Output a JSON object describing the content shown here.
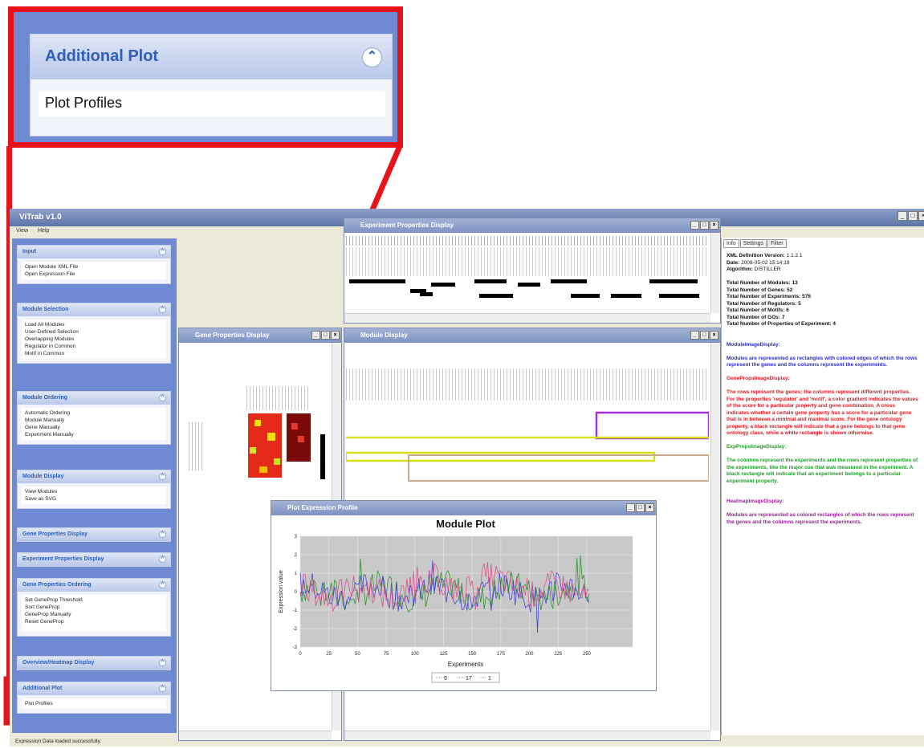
{
  "zoom": {
    "header": "Additional Plot",
    "item": "Plot Profiles"
  },
  "app": {
    "title": "ViTrab v1.0",
    "menu": [
      "View",
      "Help"
    ],
    "status": "Expression Data loaded successfully."
  },
  "sidebar": {
    "sections": [
      {
        "title": "Input",
        "items": [
          "Open Module XML File",
          "Open Expression File"
        ]
      },
      {
        "title": "Module Selection",
        "items": [
          "Load All Modules",
          "User-Defined Selection",
          "Overlapping Modules",
          "Regulator in Common",
          "Motif in Common"
        ]
      },
      {
        "title": "Module Ordering",
        "items": [
          "Automatic Ordering",
          "Module Manually",
          "Gene Manually",
          "Experiment Manually"
        ]
      },
      {
        "title": "Module Display",
        "items": [
          "View Modules",
          "Save as SVG"
        ]
      },
      {
        "title": "Gene Properties Display",
        "items": []
      },
      {
        "title": "Experiment Properties Display",
        "items": []
      },
      {
        "title": "Gene Properties Ordering",
        "items": [
          "Set GeneProp Threshold",
          "Sort GeneProp",
          "GeneProp Manually",
          "Reset GeneProp"
        ]
      },
      {
        "title": "Overview/Heatmap Display",
        "items": []
      },
      {
        "title": "Additional Plot",
        "items": [
          "Plot Profiles"
        ]
      }
    ]
  },
  "windows": {
    "experiment": "Experiment Properties Display",
    "gene": "Gene Properties Display",
    "module": "Module Display",
    "plot": "Plot Expression Profile"
  },
  "info": {
    "tabs": [
      "Info",
      "Settings",
      "Filter"
    ],
    "fields": [
      {
        "k": "XML Definition Version:",
        "v": "1.1.2.1"
      },
      {
        "k": "Date:",
        "v": "2009-05-02 15:14:19"
      },
      {
        "k": "Algorithm:",
        "v": "DISTILLER"
      }
    ],
    "totals": [
      "Total Number of Modules: 13",
      "Total Number of Genes: 52",
      "Total Number of Experiments: 576",
      "Total Number of Regulators: 5",
      "Total Number of Motifs: 6",
      "Total Number of GOs: 7",
      "Total Number of Properties of Experiment: 4"
    ],
    "blocks": [
      {
        "title": "ModuleImageDisplay:",
        "text": "Modules are represented as rectangles with colored edges of which the rows represent the genes and the columns represent the experiments.",
        "color": "#2b2bd9"
      },
      {
        "title": "GenePropsImageDisplay:",
        "text": "The rows represent the genes; the columns represent different properties. For the properties 'regulator' and 'motif', a color gradient indicates the values of the score for a particular property and gene combination. A cross indicates whether a certain gene property has a score for a particular gene that is in between a minimal and maximal score. For the gene ontology property, a black rectangle will indicate that a gene belongs to that gene ontology class, while a white rectangle is shown otherwise.",
        "color": "#e5161f"
      },
      {
        "title": "ExpPropsImageDisplay:",
        "text": "The columns represent the experiments and the rows represent properties of the experiments, like the major cue that was measured in the experiment. A black rectangle will indicate that an experiment belongs to a particular experiment property.",
        "color": "#1f9d2a"
      },
      {
        "title": "HeatmapImageDisplay:",
        "text": "Modules are represented as colored rectangles of which the rows represent the genes and the columns represent the experiments.",
        "color": "#9a1f9a"
      }
    ]
  },
  "chart_data": {
    "type": "line",
    "title": "Module Plot",
    "xlabel": "Experiments",
    "ylabel": "Expression value",
    "xlim": [
      0,
      290
    ],
    "ylim": [
      -3,
      3
    ],
    "xticks": [
      0,
      25,
      50,
      75,
      100,
      125,
      150,
      175,
      200,
      225,
      250
    ],
    "yticks": [
      3,
      2,
      1,
      0,
      -1,
      -2,
      -3
    ],
    "legend": [
      "9",
      "17",
      "1"
    ],
    "series_colors": [
      "#1f8f1f",
      "#3a3ad6",
      "#e0468a"
    ],
    "grid": true
  }
}
